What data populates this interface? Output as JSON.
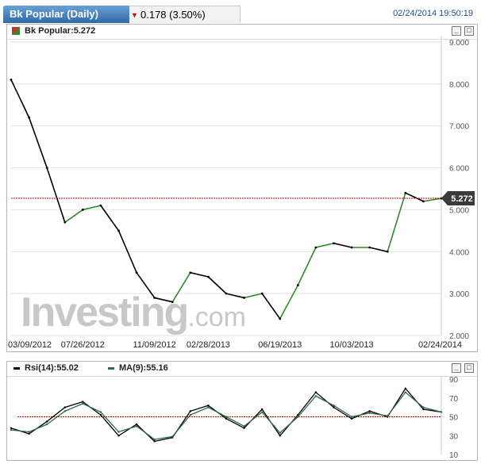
{
  "header": {
    "tab_title": "Bk Popular (Daily)",
    "change": "0.178 (3.50%)",
    "datetime": "02/24/2014 19:50:19"
  },
  "price_panel": {
    "label": "Bk Popular:5.272",
    "last_price_label": "5.272",
    "minimize": "_",
    "maximize": "□"
  },
  "watermark": {
    "brand": "Investing",
    "domain": ".com"
  },
  "rsi_panel": {
    "rsi_label": "Rsi(14):55.02",
    "ma_label": "MA(9):55.16",
    "minimize": "_",
    "maximize": "□"
  },
  "colors": {
    "up": "#2e8b2e",
    "down": "#000000",
    "reference_line": "#cc0000",
    "ma_line": "#2e6b4e",
    "tab_blue": "#2f6aa8",
    "last_price_bg": "#3a3a3a"
  },
  "chart_data": [
    {
      "type": "line",
      "title": "Bk Popular:5.272",
      "x": [
        "03/09/2012",
        "04/2012",
        "05/2012",
        "06/2012",
        "07/26/2012",
        "08/2012",
        "09/2012",
        "10/2012",
        "11/09/2012",
        "12/2012",
        "01/2013",
        "02/28/2013",
        "03/2013",
        "04/2013",
        "05/2013",
        "06/19/2013",
        "07/2013",
        "08/2013",
        "09/2013",
        "10/03/2013",
        "11/2013",
        "12/2013",
        "01/2014",
        "02/2014",
        "02/24/2014"
      ],
      "series": [
        {
          "values": [
            8.1,
            7.2,
            6.0,
            4.7,
            5.0,
            5.1,
            4.5,
            3.5,
            2.9,
            2.8,
            3.5,
            3.4,
            3.0,
            2.9,
            3.0,
            2.4,
            3.2,
            4.1,
            4.2,
            4.1,
            4.1,
            4.0,
            5.4,
            5.2,
            5.272
          ]
        }
      ],
      "x_tick_labels": [
        "03/09/2012",
        "07/26/2012",
        "11/09/2012",
        "02/28/2013",
        "06/19/2013",
        "10/03/2013",
        "02/24/2014"
      ],
      "y_tick_labels": [
        "2.000",
        "3.000",
        "4.000",
        "5.000",
        "6.000",
        "7.000",
        "8.000",
        "9.000"
      ],
      "ylim": [
        2,
        9
      ],
      "reference_line": 5.272,
      "last_value": "5.272",
      "grid": true
    },
    {
      "type": "line",
      "x": [
        "03/09/2012",
        "04/2012",
        "05/2012",
        "06/2012",
        "07/26/2012",
        "08/2012",
        "09/2012",
        "10/2012",
        "11/09/2012",
        "12/2012",
        "01/2013",
        "02/28/2013",
        "03/2013",
        "04/2013",
        "05/2013",
        "06/19/2013",
        "07/2013",
        "08/2013",
        "09/2013",
        "10/03/2013",
        "11/2013",
        "12/2013",
        "01/2014",
        "02/2014",
        "02/24/2014"
      ],
      "series": [
        {
          "name": "Rsi(14):55.02",
          "values": [
            38,
            32,
            45,
            60,
            66,
            52,
            30,
            42,
            24,
            28,
            56,
            62,
            48,
            38,
            58,
            30,
            52,
            76,
            60,
            48,
            56,
            50,
            80,
            58,
            55.02
          ]
        },
        {
          "name": "MA(9):55.16",
          "values": [
            36,
            34,
            42,
            56,
            64,
            55,
            34,
            40,
            26,
            29,
            52,
            60,
            50,
            40,
            55,
            33,
            50,
            72,
            62,
            50,
            54,
            51,
            76,
            60,
            55.16
          ]
        }
      ],
      "y_tick_labels": [
        "10",
        "30",
        "50",
        "70",
        "90"
      ],
      "ylim": [
        10,
        90
      ],
      "reference_line": 50,
      "grid": false
    }
  ]
}
